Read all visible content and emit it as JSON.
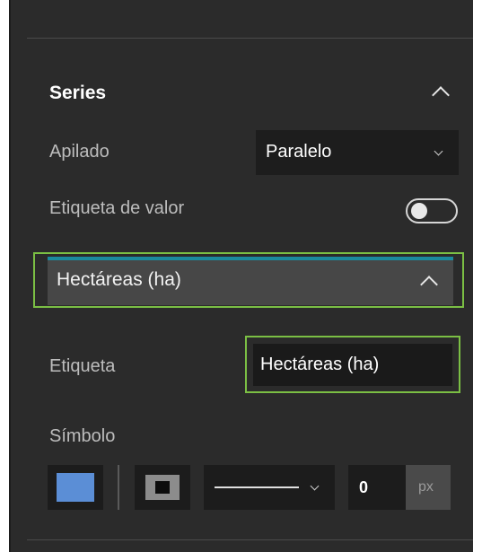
{
  "series_section": {
    "title": "Series",
    "stacking": {
      "label": "Apilado",
      "selected": "Paralelo"
    },
    "value_label": {
      "label": "Etiqueta de valor",
      "enabled": false
    }
  },
  "series_item": {
    "title": "Hectáreas (ha)",
    "label_field": {
      "label": "Etiqueta",
      "value": "Hectáreas (ha)"
    },
    "symbol": {
      "label": "Símbolo",
      "fill_color": "#5b8ed6",
      "line_width": "0",
      "unit": "px"
    }
  },
  "colors": {
    "panel_bg": "#2b2b2b",
    "accent_teal": "#1a8a9e",
    "highlight_green": "#7bbf44"
  }
}
